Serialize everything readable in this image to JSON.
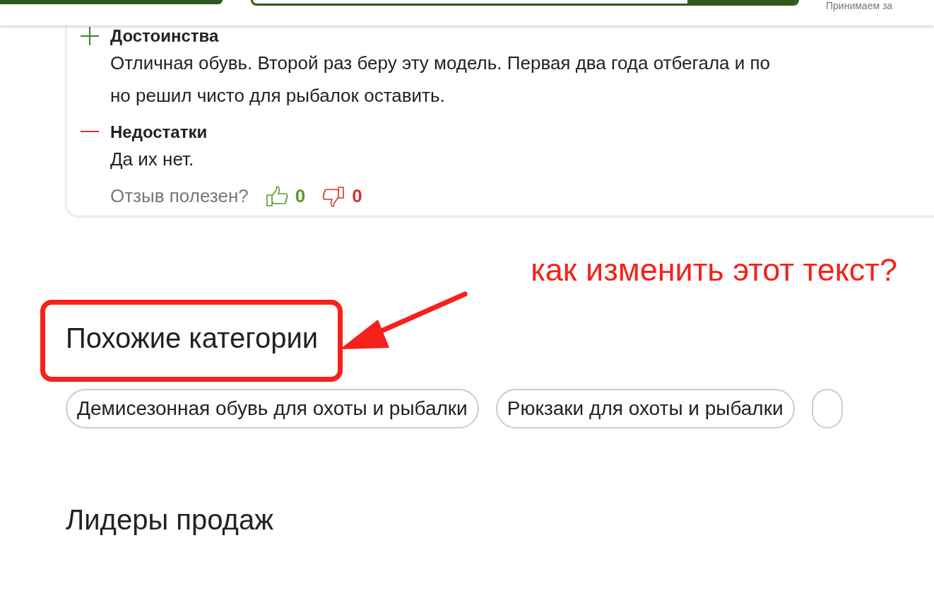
{
  "header": {
    "notice": "Принимаем за"
  },
  "review": {
    "pros": {
      "title": "Достоинства",
      "text": "Отличная обувь. Второй раз беру эту модель. Первая два года отбегала и по\nно решил чисто для рыбалок оставить."
    },
    "cons": {
      "title": "Недостатки",
      "text": "Да их нет."
    },
    "helpful": {
      "question": "Отзыв полезен?",
      "likes": "0",
      "dislikes": "0"
    }
  },
  "annotation": {
    "text": "как изменить этот текст?"
  },
  "similar": {
    "title": "Похожие категории",
    "chips": [
      "Демисезонная обувь для охоты и рыбалки",
      "Рюкзаки для охоты и рыбалки"
    ]
  },
  "bestsellers": {
    "title": "Лидеры продаж"
  }
}
